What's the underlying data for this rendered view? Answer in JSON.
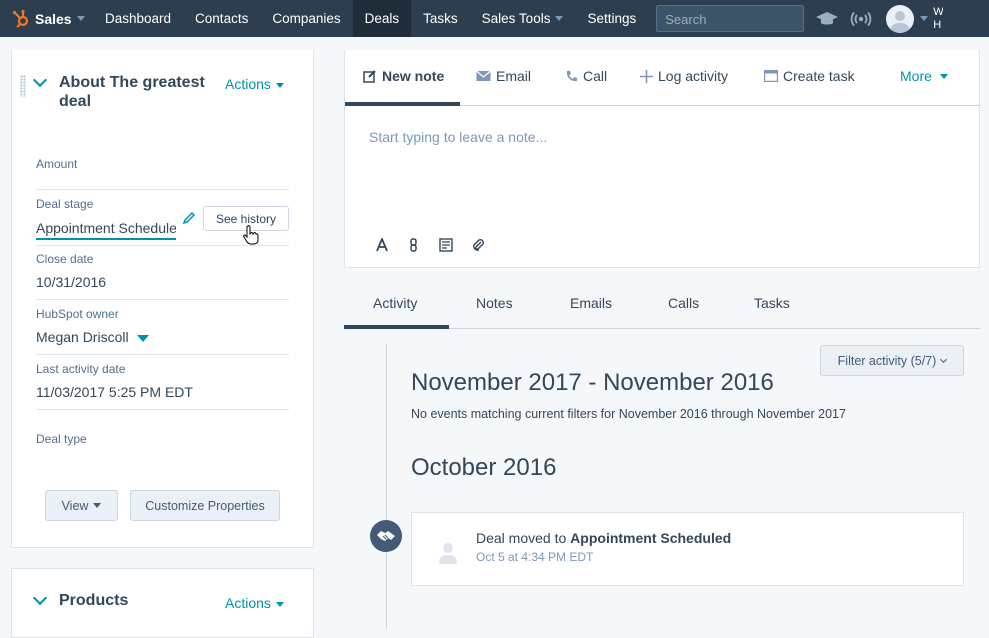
{
  "nav": {
    "brand": "Sales",
    "items": [
      {
        "label": "Dashboard"
      },
      {
        "label": "Contacts"
      },
      {
        "label": "Companies"
      },
      {
        "label": "Deals",
        "active": true
      },
      {
        "label": "Tasks"
      },
      {
        "label": "Sales Tools",
        "dropdown": true
      },
      {
        "label": "Settings"
      }
    ],
    "search_placeholder": "Search",
    "account_text": "W H"
  },
  "about": {
    "title": "About The greatest deal",
    "actions_label": "Actions",
    "props": {
      "amount_label": "Amount",
      "amount_value": "",
      "stage_label": "Deal stage",
      "stage_value": "Appointment Scheduled",
      "see_history": "See history",
      "close_label": "Close date",
      "close_value": "10/31/2016",
      "owner_label": "HubSpot owner",
      "owner_value": "Megan Driscoll",
      "last_label": "Last activity date",
      "last_value": "11/03/2017 5:25 PM EDT",
      "type_label": "Deal type"
    },
    "view_label": "View",
    "customize_label": "Customize Properties"
  },
  "products": {
    "title": "Products",
    "actions_label": "Actions"
  },
  "composer": {
    "tabs": {
      "note": "New note",
      "email": "Email",
      "call": "Call",
      "log": "Log activity",
      "task": "Create task",
      "more": "More"
    },
    "placeholder": "Start typing to leave a note..."
  },
  "activity": {
    "tabs": {
      "activity": "Activity",
      "notes": "Notes",
      "emails": "Emails",
      "calls": "Calls",
      "tasks": "Tasks"
    },
    "filter_label": "Filter activity (5/7)",
    "month1": "November 2017 - November 2016",
    "no_events": "No events matching current filters for November 2016 through November 2017",
    "month2": "October 2016",
    "event": {
      "prefix": "Deal moved to ",
      "stage": "Appointment Scheduled",
      "time": "Oct 5 at 4:34 PM EDT"
    }
  }
}
